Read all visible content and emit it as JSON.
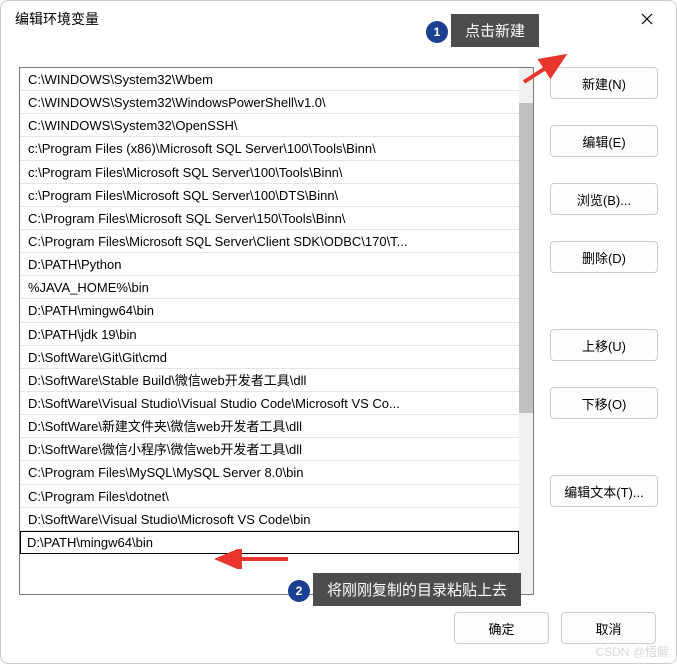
{
  "dialog": {
    "title": "编辑环境变量"
  },
  "path_entries": [
    "C:\\WINDOWS\\System32\\Wbem",
    "C:\\WINDOWS\\System32\\WindowsPowerShell\\v1.0\\",
    "C:\\WINDOWS\\System32\\OpenSSH\\",
    "c:\\Program Files (x86)\\Microsoft SQL Server\\100\\Tools\\Binn\\",
    "c:\\Program Files\\Microsoft SQL Server\\100\\Tools\\Binn\\",
    "c:\\Program Files\\Microsoft SQL Server\\100\\DTS\\Binn\\",
    "C:\\Program Files\\Microsoft SQL Server\\150\\Tools\\Binn\\",
    "C:\\Program Files\\Microsoft SQL Server\\Client SDK\\ODBC\\170\\T...",
    "D:\\PATH\\Python",
    "%JAVA_HOME%\\bin",
    "D:\\PATH\\mingw64\\bin",
    "D:\\PATH\\jdk 19\\bin",
    "D:\\SoftWare\\Git\\Git\\cmd",
    "D:\\SoftWare\\Stable Build\\微信web开发者工具\\dll",
    "D:\\SoftWare\\Visual Studio\\Visual Studio Code\\Microsoft VS Co...",
    "D:\\SoftWare\\新建文件夹\\微信web开发者工具\\dll",
    "D:\\SoftWare\\微信小程序\\微信web开发者工具\\dll",
    "C:\\Program Files\\MySQL\\MySQL Server 8.0\\bin",
    "C:\\Program Files\\dotnet\\",
    "D:\\SoftWare\\Visual Studio\\Microsoft VS Code\\bin",
    "D:\\PATH\\mingw64\\bin"
  ],
  "edit_value": "D:\\PATH\\mingw64\\bin",
  "selected_index": 20,
  "buttons": {
    "new": "新建(N)",
    "edit": "编辑(E)",
    "browse": "浏览(B)...",
    "delete": "删除(D)",
    "move_up": "上移(U)",
    "move_down": "下移(O)",
    "edit_text": "编辑文本(T)...",
    "ok": "确定",
    "cancel": "取消"
  },
  "annotations": {
    "step1_num": "1",
    "step1_label": "点击新建",
    "step2_num": "2",
    "step2_label": "将刚刚复制的目录粘贴上去"
  },
  "watermark": "CSDN @悟解"
}
